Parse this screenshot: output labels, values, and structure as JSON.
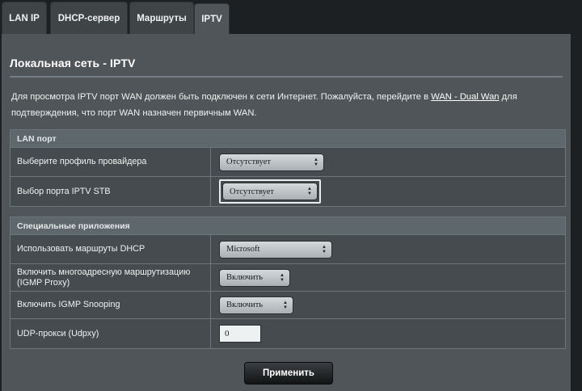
{
  "tabs": [
    {
      "label": "LAN IP"
    },
    {
      "label": "DHCP-сервер"
    },
    {
      "label": "Маршруты"
    },
    {
      "label": "IPTV"
    }
  ],
  "page": {
    "title": "Локальная сеть - IPTV",
    "description_before": "Для просмотра IPTV порт WAN должен быть подключен к сети Интернет. Пожалуйста, перейдите в ",
    "description_link": "WAN - Dual Wan",
    "description_after": " для подтверждения, что порт WAN назначен первичным WAN."
  },
  "lan_port": {
    "header": "LAN порт",
    "provider_profile": {
      "label": "Выберите профиль провайдера",
      "value": "Отсутствует"
    },
    "stb_port": {
      "label": "Выбор порта IPTV STB",
      "value": "Отсутствует"
    }
  },
  "special_apps": {
    "header": "Специальные приложения",
    "dhcp_routes": {
      "label": "Использовать маршруты DHCP",
      "value": "Microsoft"
    },
    "igmp_proxy": {
      "label": "Включить многоадресную маршрутизацию (IGMP Proxy)",
      "value": "Включить"
    },
    "igmp_snooping": {
      "label": "Включить IGMP Snooping",
      "value": "Включить"
    },
    "udpxy": {
      "label": "UDP-прокси (Udpxy)",
      "value": "0"
    }
  },
  "apply_label": "Применить",
  "colors": {
    "panel": "#4f5558",
    "background": "#1c2022",
    "header_row": "#5e676b"
  }
}
